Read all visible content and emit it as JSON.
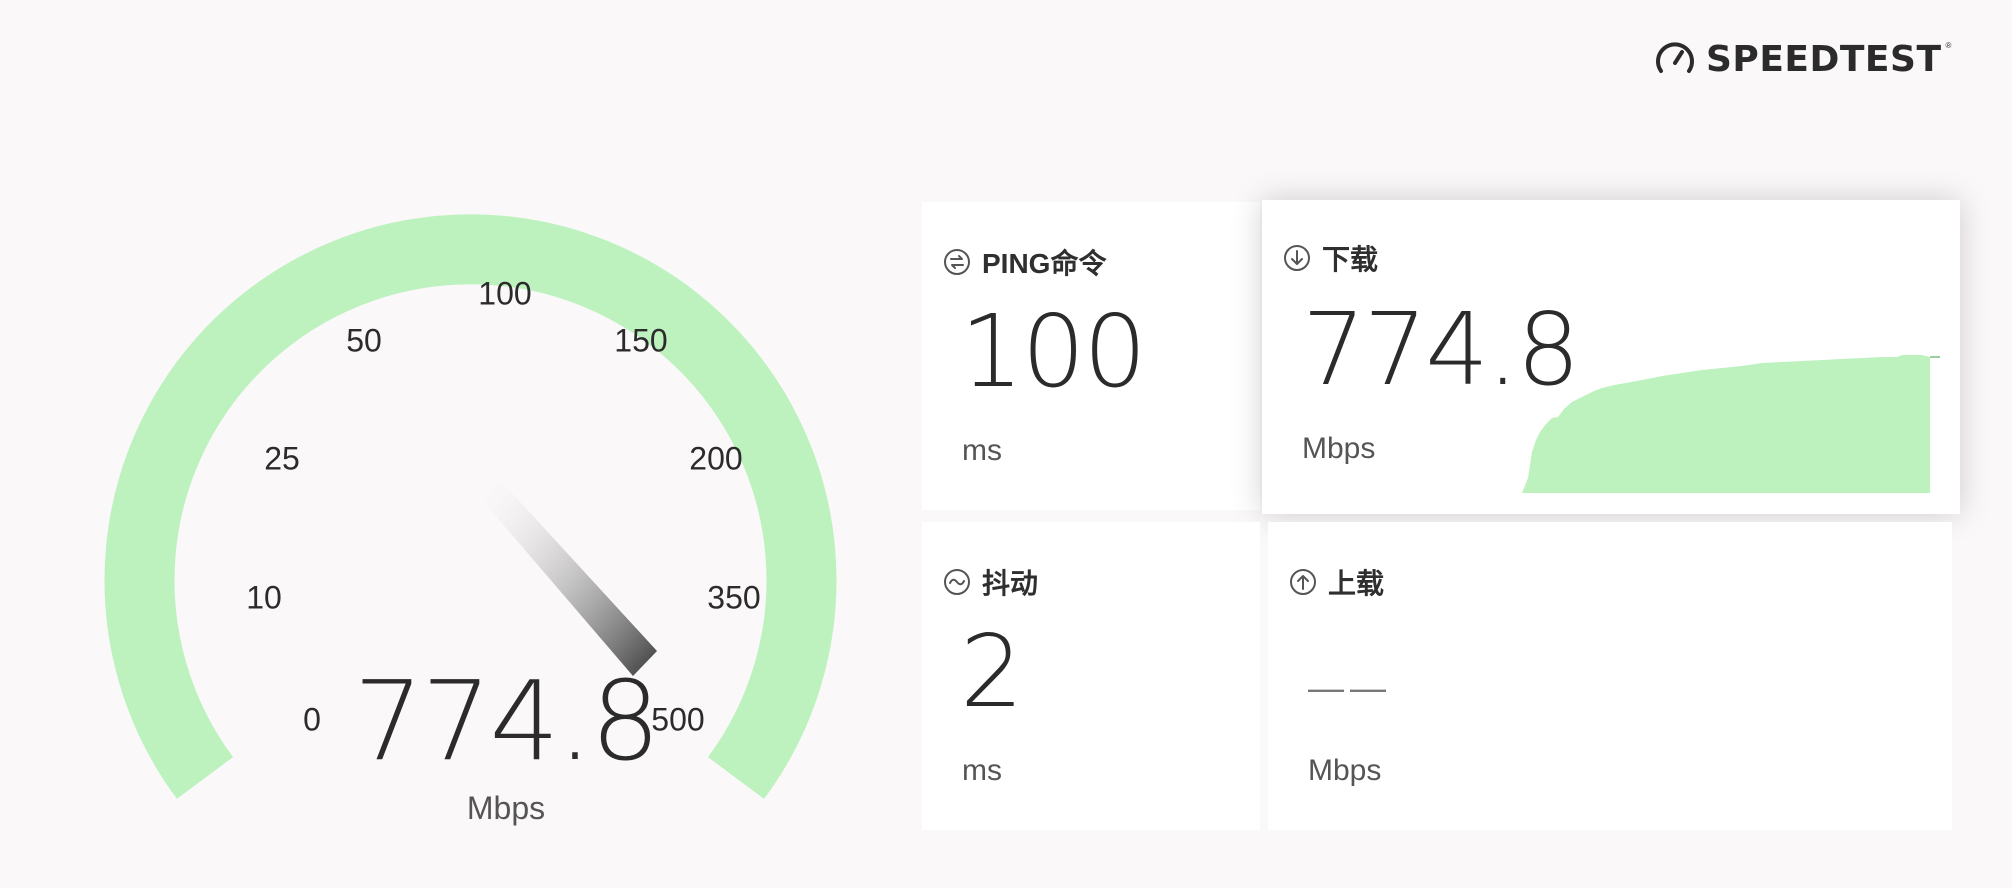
{
  "brand": {
    "name": "SPEEDTEST",
    "tm": "®"
  },
  "gauge": {
    "ticks": [
      "0",
      "10",
      "25",
      "50",
      "100",
      "150",
      "200",
      "350",
      "500"
    ],
    "value": "774.8",
    "unit": "Mbps",
    "level_fraction": 1.0
  },
  "cards": {
    "ping": {
      "label": "PING命令",
      "value": "100",
      "unit": "ms"
    },
    "download": {
      "label": "下载",
      "value": "774.8",
      "unit": "Mbps"
    },
    "jitter": {
      "label": "抖动",
      "value": "2",
      "unit": "ms"
    },
    "upload": {
      "label": "上载",
      "value": "——",
      "unit": "Mbps"
    }
  },
  "colors": {
    "gauge_fill": "#bdf2bf",
    "graph_fill": "#bdf2bf",
    "text": "#2b2b2b",
    "background": "#fbf8fa"
  },
  "icons": {
    "brand": "speedometer-icon",
    "ping": "ping-icon",
    "download": "download-arrow-icon",
    "jitter": "jitter-wave-icon",
    "upload": "upload-arrow-icon"
  }
}
